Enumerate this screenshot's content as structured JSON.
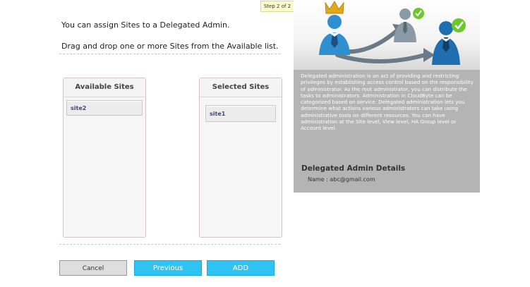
{
  "wizard": {
    "step_label": "Step 2 of 2"
  },
  "intro": {
    "line1": "You can assign Sites to a Delegated Admin.",
    "line2": "Drag and drop one or more Sites from the Available list."
  },
  "available": {
    "title": "Available Sites",
    "items": [
      "site2"
    ]
  },
  "selected": {
    "title": "Selected Sites",
    "items": [
      "site1"
    ]
  },
  "buttons": {
    "cancel": "Cancel",
    "previous": "Previous",
    "add": "ADD"
  },
  "info": {
    "description": "Delegated administration is an act of providing and restricting privileges by establishing access control based on the responsibility of administrator. As the root administrator, you can distribute the tasks to administrators. Administration in CloudByte can be categorized based on service. Delegated administration lets you determine what actions various administrators can take using administrative tools on different resources. You can have administration at the Site level, View level, HA Group level or Account level.",
    "details_title": "Delegated Admin Details",
    "name_line": "Name : abc@gmail.com"
  },
  "colors": {
    "button_primary": "#2fc4f4",
    "check_green": "#6cc72b",
    "admin_blue": "#2f8fd0",
    "crown_gold": "#e2a81c",
    "panel_gray": "#b4b4b4"
  }
}
